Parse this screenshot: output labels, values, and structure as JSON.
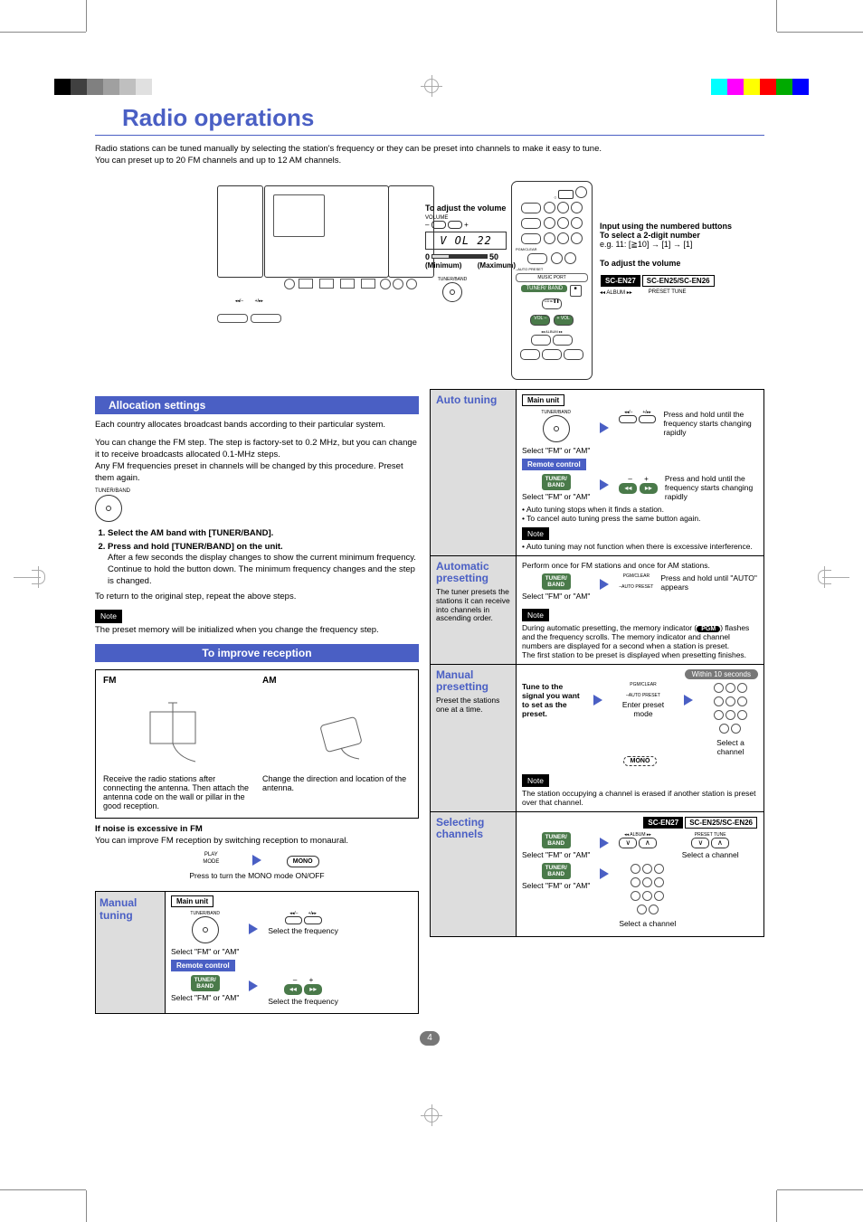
{
  "title": "Radio operations",
  "intro_line1": "Radio stations can be tuned manually by selecting the station's frequency or they can be preset into channels to make it easy to tune.",
  "intro_line2": "You can preset up to 20 FM channels and up to 12 AM channels.",
  "vol_callout": {
    "heading": "To adjust the volume",
    "volume_label": "VOLUME",
    "minus": "–",
    "plus": "+",
    "display": "V OL 22",
    "min_val": "0",
    "max_val": "50",
    "min_label": "(Minimum)",
    "max_label": "(Maximum)",
    "tuner_band": "TUNER/BAND"
  },
  "remote_callouts": {
    "input_title": "Input using the numbered buttons",
    "select_title": "To select a 2-digit number",
    "select_example": "e.g. 11: [≧10] → [1] → [1]",
    "adjust_vol": "To adjust the volume",
    "model_a": "SC-EN27",
    "model_b": "SC-EN25/SC-EN26",
    "album_label": "◂◂ ALBUM ▸▸",
    "preset_label": "PRESET TUNE",
    "vol_minus": "VOL –",
    "vol_plus": "+ VOL",
    "tuner_band": "TUNER/\nBAND",
    "cd_label": "CD\n▸/❚❚",
    "music_port": "MUSIC PORT"
  },
  "allocation": {
    "header": "Allocation settings",
    "p1": "Each country allocates broadcast bands according to their particular system.",
    "p2": "You can change the FM step. The step is factory-set to 0.2 MHz, but you can change it to receive broadcasts allocated 0.1-MHz steps.",
    "p3": "Any FM frequencies preset in channels will be changed by this procedure. Preset them again.",
    "tuner_band": "TUNER/BAND",
    "step1": "Select the AM band with [TUNER/BAND].",
    "step2": "Press and hold [TUNER/BAND] on the unit.",
    "step2_detail": "After a few seconds the display changes to show the current minimum frequency. Continue to hold the button down. The minimum frequency changes and the step is changed.",
    "return": "To return to the original step, repeat the above steps.",
    "note_label": "Note",
    "note_text": "The preset memory will be initialized when you change the frequency step."
  },
  "reception": {
    "header": "To improve reception",
    "fm": "FM",
    "am": "AM",
    "fm_text": "Receive the radio stations after connecting the antenna. Then attach the antenna code on the wall or pillar in the good reception.",
    "am_text": "Change the direction and location of the antenna.",
    "noise_title": "If noise is excessive in FM",
    "noise_text": "You can improve FM reception by switching reception to monaural.",
    "play_mode": "PLAY\nMODE",
    "mono": "MONO",
    "mono_caption": "Press to turn the MONO mode ON/OFF"
  },
  "manual_tuning": {
    "label": "Manual tuning",
    "main_unit": "Main unit",
    "tuner_band": "TUNER/BAND",
    "select_fm_am": "Select \"FM\" or \"AM\"",
    "remote_control": "Remote control",
    "tuner_band_green": "TUNER/\nBAND",
    "select_freq": "Select the frequency",
    "minus": "–",
    "plus": "+",
    "skip_prev": "◂◂/–",
    "skip_next": "+/▸▸"
  },
  "auto_tuning": {
    "label": "Auto tuning",
    "main_unit": "Main unit",
    "tuner_band": "TUNER/BAND",
    "select_fm_am": "Select \"FM\" or \"AM\"",
    "instruction": "Press and hold until the frequency starts changing rapidly",
    "remote_control": "Remote control",
    "tuner_band_green": "TUNER/\nBAND",
    "minus": "–",
    "plus": "+",
    "bullet1": "• Auto tuning stops when it finds a station.",
    "bullet2": "• To cancel auto tuning press the same button again.",
    "note_label": "Note",
    "note_text": "• Auto tuning may not function when there is excessive interference."
  },
  "auto_preset": {
    "label": "Automatic presetting",
    "sub": "The tuner presets the stations it can receive into channels in ascending order.",
    "perform": "Perform once for FM stations and once for AM stations.",
    "tuner_band_green": "TUNER/\nBAND",
    "select_fm_am": "Select \"FM\" or \"AM\"",
    "pgm_clear": "PGM/CLEAR",
    "auto_preset_lbl": "–AUTO PRESET",
    "instruction": "Press and hold until \"AUTO\" appears",
    "note_label": "Note",
    "note_text1": "During automatic presetting, the memory indicator (",
    "pgm": "PGM",
    "note_text1b": ") flashes and the frequency scrolls. The memory indicator and channel numbers are displayed for a second when a station is preset.",
    "note_text2": "The first station to be preset is displayed when presetting finishes."
  },
  "manual_preset": {
    "label": "Manual presetting",
    "sub": "Preset the stations one at a time.",
    "tune": "Tune to the signal you want to set as the preset.",
    "pgm_clear": "PGM/CLEAR",
    "auto_preset_lbl": "–AUTO PRESET",
    "enter_preset": "Enter preset mode",
    "within": "Within 10 seconds",
    "select_channel": "Select a channel",
    "note_label": "Note",
    "note_text": "The station occupying a channel is erased if another station is preset over that channel.",
    "mono_dashed": "MONO"
  },
  "selecting": {
    "label": "Selecting channels",
    "model_a": "SC-EN27",
    "model_b": "SC-EN25/SC-EN26",
    "tuner_band_green": "TUNER/\nBAND",
    "select_fm_am": "Select \"FM\" or \"AM\"",
    "album_label": "◂◂ ALBUM ▸▸",
    "preset_label": "PRESET TUNE",
    "select_channel": "Select a channel",
    "down": "∨",
    "up": "∧"
  },
  "page_number": "4"
}
